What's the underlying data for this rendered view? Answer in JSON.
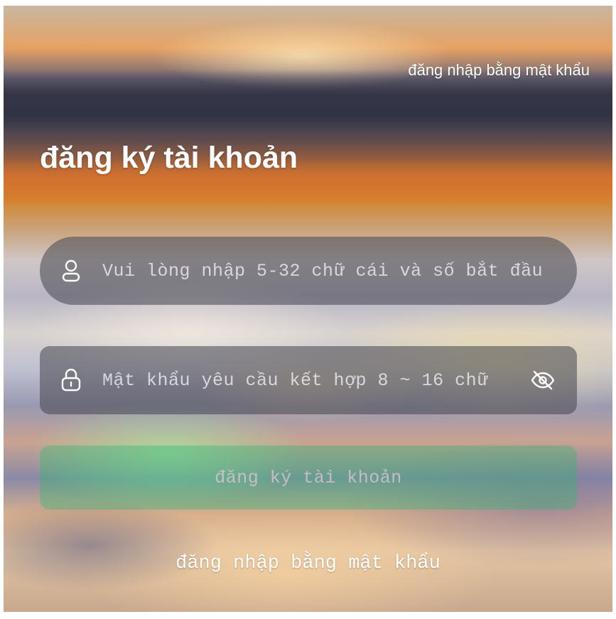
{
  "header": {
    "password_login_link": "đăng nhập bằng mật khẩu"
  },
  "page": {
    "title": "đăng ký tài khoản"
  },
  "form": {
    "username": {
      "icon": "user-icon",
      "value": "",
      "placeholder": "Vui lòng nhập 5-32 chữ cái và số bắt đầu"
    },
    "password": {
      "icon": "lock-icon",
      "value": "",
      "placeholder": "Mật khẩu yêu cầu kết hợp 8 ~ 16 chữ",
      "toggle_icon": "eye-off-icon"
    },
    "submit_label": "đăng ký tài khoản"
  },
  "footer": {
    "password_login_link": "đăng nhập bằng mật khẩu"
  },
  "colors": {
    "text": "#ffffff",
    "submit_button": "#32b96e"
  }
}
